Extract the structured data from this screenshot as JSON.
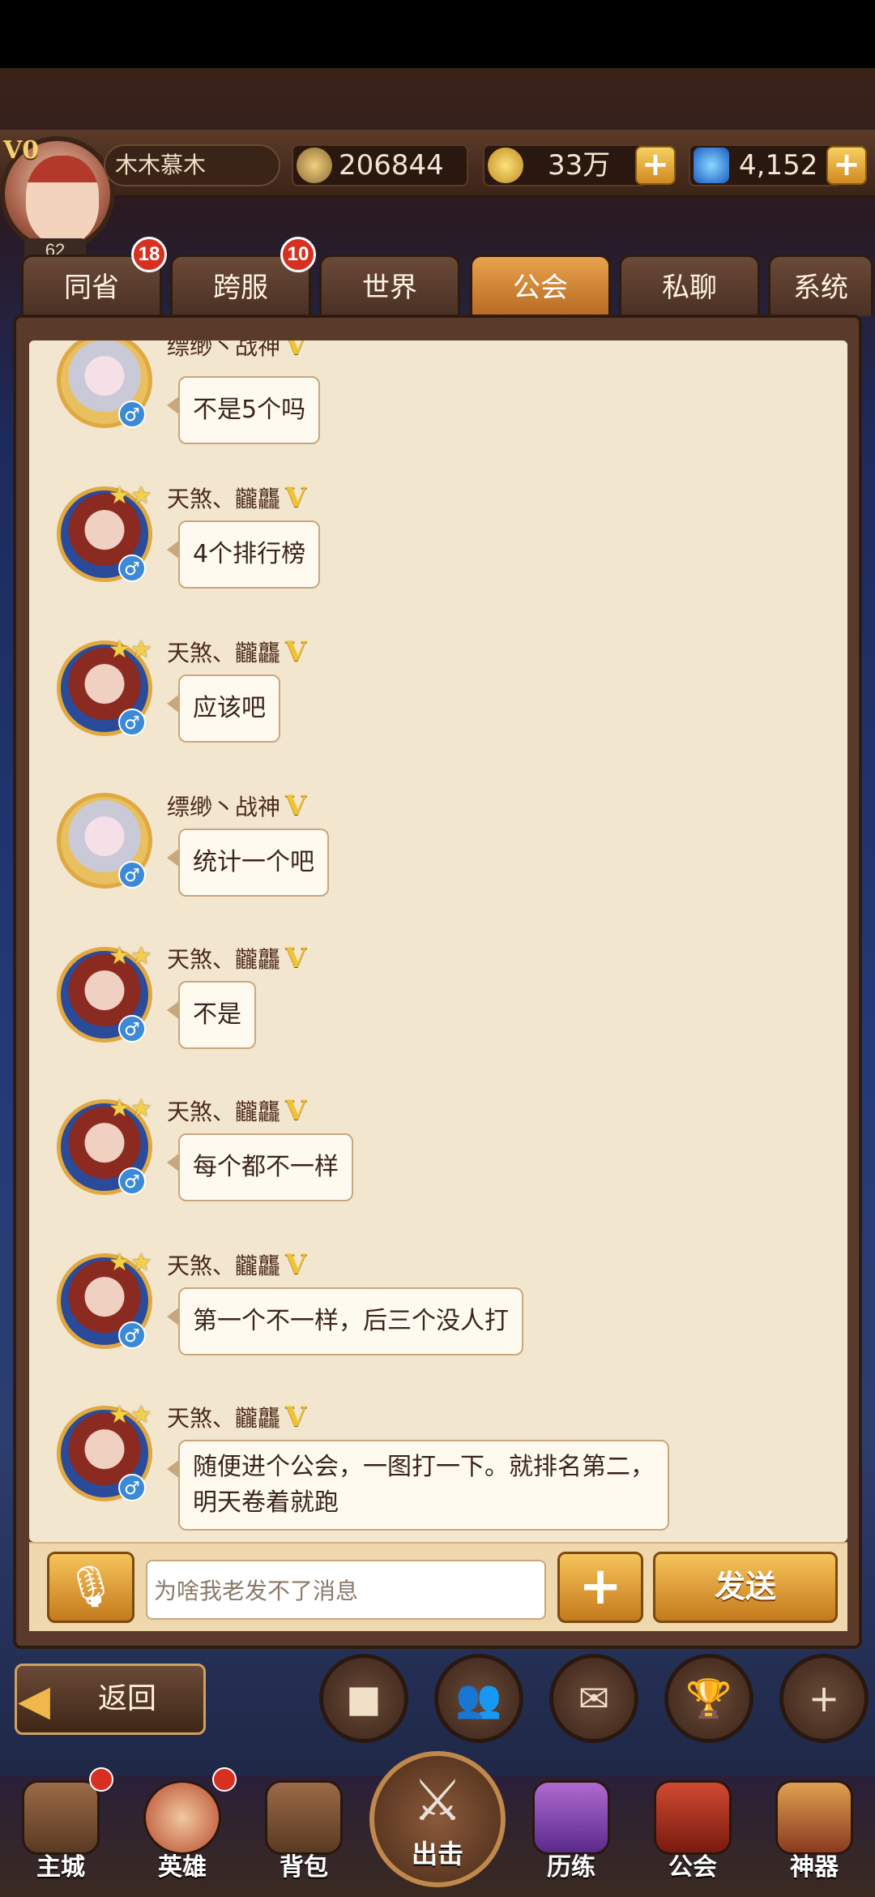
{
  "player": {
    "vip": "V0",
    "level": "62",
    "name": "木木慕木",
    "power": "206844",
    "gold": "33万",
    "gems": "4,152"
  },
  "tabs": [
    {
      "label": "同省",
      "badge": "18"
    },
    {
      "label": "跨服",
      "badge": "10"
    },
    {
      "label": "世界"
    },
    {
      "label": "公会",
      "active": true
    },
    {
      "label": "私聊"
    },
    {
      "label": "系统"
    }
  ],
  "messages": [
    {
      "name": "缥缈丶战神",
      "vip": "V",
      "text": "不是5个吗"
    },
    {
      "name": "天煞、龖龘",
      "vip": "V",
      "text": "4个排行榜"
    },
    {
      "name": "天煞、龖龘",
      "vip": "V",
      "text": "应该吧"
    },
    {
      "name": "缥缈丶战神",
      "vip": "V",
      "text": "统计一个吧"
    },
    {
      "name": "天煞、龖龘",
      "vip": "V",
      "text": "不是"
    },
    {
      "name": "天煞、龖龘",
      "vip": "V",
      "text": "每个都不一样"
    },
    {
      "name": "天煞、龖龘",
      "vip": "V",
      "text": "第一个不一样，后三个没人打"
    },
    {
      "name": "天煞、龖龘",
      "vip": "V",
      "text": "随便进个公会，一图打一下。就排名第二，\n明天卷着就跑"
    }
  ],
  "input": {
    "value": "为啥我老发不了消息",
    "send_label": "发送"
  },
  "back_label": "返回",
  "nav": [
    {
      "label": "主城"
    },
    {
      "label": "英雄"
    },
    {
      "label": "背包"
    },
    {
      "label": "出击"
    },
    {
      "label": "历练"
    },
    {
      "label": "公会"
    },
    {
      "label": "神器"
    }
  ]
}
